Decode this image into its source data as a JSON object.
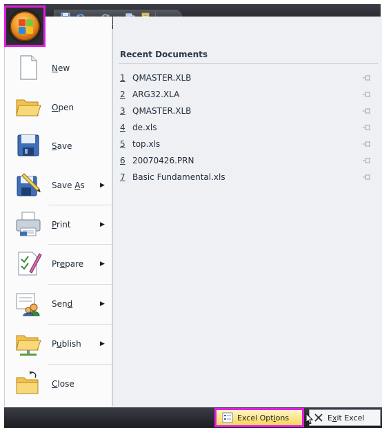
{
  "quick_access": {
    "items": [
      {
        "name": "save-icon",
        "glyph": "▣"
      },
      {
        "name": "undo-icon",
        "glyph": "↶"
      },
      {
        "name": "redo-icon",
        "glyph": "↷"
      },
      {
        "name": "windows-icon",
        "glyph": "▦"
      },
      {
        "name": "sheet-icon",
        "glyph": "▤"
      }
    ],
    "more_glyph": "▿"
  },
  "office_button": {
    "icon": "office-logo-icon"
  },
  "left_menu": [
    {
      "id": "new",
      "label": "New",
      "accel_index": 0,
      "has_submenu": false,
      "icon": "new-document-icon"
    },
    {
      "id": "open",
      "label": "Open",
      "accel_index": 0,
      "has_submenu": false,
      "icon": "open-folder-icon"
    },
    {
      "id": "save",
      "label": "Save",
      "accel_index": 0,
      "has_submenu": false,
      "icon": "save-disk-icon"
    },
    {
      "id": "save-as",
      "label": "Save As",
      "accel_index": 5,
      "has_submenu": true,
      "icon": "save-as-icon"
    },
    {
      "id": "print",
      "label": "Print",
      "accel_index": 0,
      "has_submenu": true,
      "icon": "printer-icon"
    },
    {
      "id": "prepare",
      "label": "Prepare",
      "accel_index": 2,
      "has_submenu": true,
      "icon": "prepare-icon"
    },
    {
      "id": "send",
      "label": "Send",
      "accel_index": 3,
      "has_submenu": true,
      "icon": "send-icon"
    },
    {
      "id": "publish",
      "label": "Publish",
      "accel_index": 1,
      "has_submenu": true,
      "icon": "publish-icon"
    },
    {
      "id": "close",
      "label": "Close",
      "accel_index": 0,
      "has_submenu": false,
      "icon": "close-folder-icon"
    }
  ],
  "recent_documents": {
    "title": "Recent Documents",
    "items": [
      {
        "num": "1",
        "name": "QMASTER.XLB"
      },
      {
        "num": "2",
        "name": "ARG32.XLA"
      },
      {
        "num": "3",
        "name": "QMASTER.XLB"
      },
      {
        "num": "4",
        "name": "de.xls"
      },
      {
        "num": "5",
        "name": "top.xls"
      },
      {
        "num": "6",
        "name": "20070426.PRN"
      },
      {
        "num": "7",
        "name": "Basic Fundamental.xls"
      }
    ]
  },
  "footer": {
    "options_label": "Excel Options",
    "exit_label": "Exit Excel"
  },
  "colors": {
    "highlight": "#e01ee0",
    "office_orange": "#f0a030",
    "options_yellow": "#f8d65a"
  }
}
